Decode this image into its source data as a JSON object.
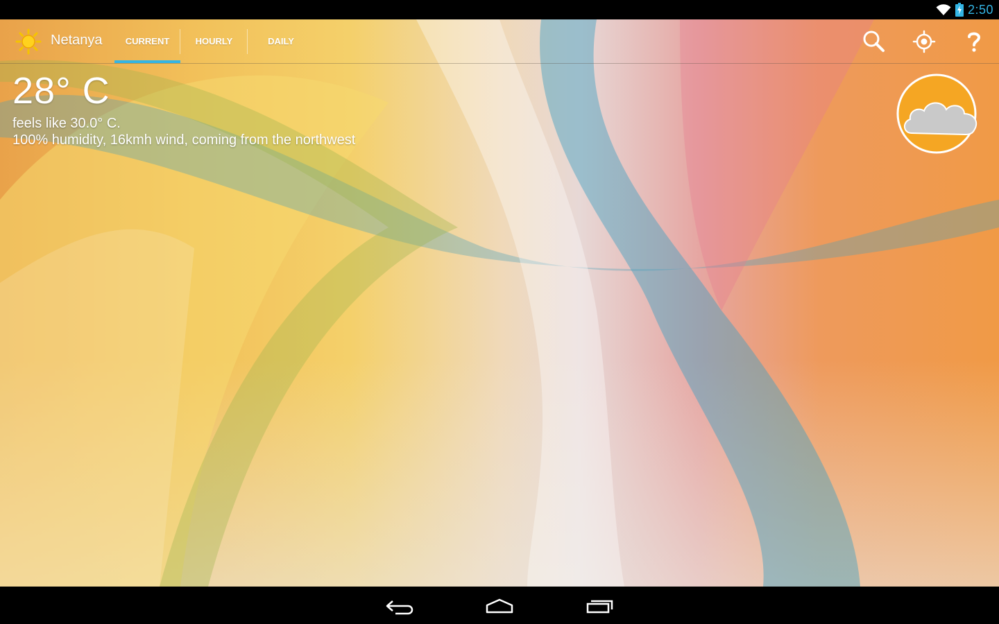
{
  "status_bar": {
    "time": "2:50"
  },
  "app": {
    "city": "Netanya",
    "tabs": [
      {
        "label": "CURRENT",
        "active": true
      },
      {
        "label": "HOURLY",
        "active": false
      },
      {
        "label": "DAILY",
        "active": false
      }
    ],
    "actions": [
      "search-icon",
      "my-location-icon",
      "help-icon"
    ]
  },
  "current": {
    "temperature": "28° C",
    "feels_like": "feels like 30.0° C.",
    "details": "100% humidity, 16kmh wind, coming from the northwest",
    "condition_icon": "partly-cloudy-icon"
  },
  "navigation": [
    "back-icon",
    "home-icon",
    "recents-icon"
  ],
  "colors": {
    "accent": "#33b5e5",
    "sun": "#f5a623"
  }
}
